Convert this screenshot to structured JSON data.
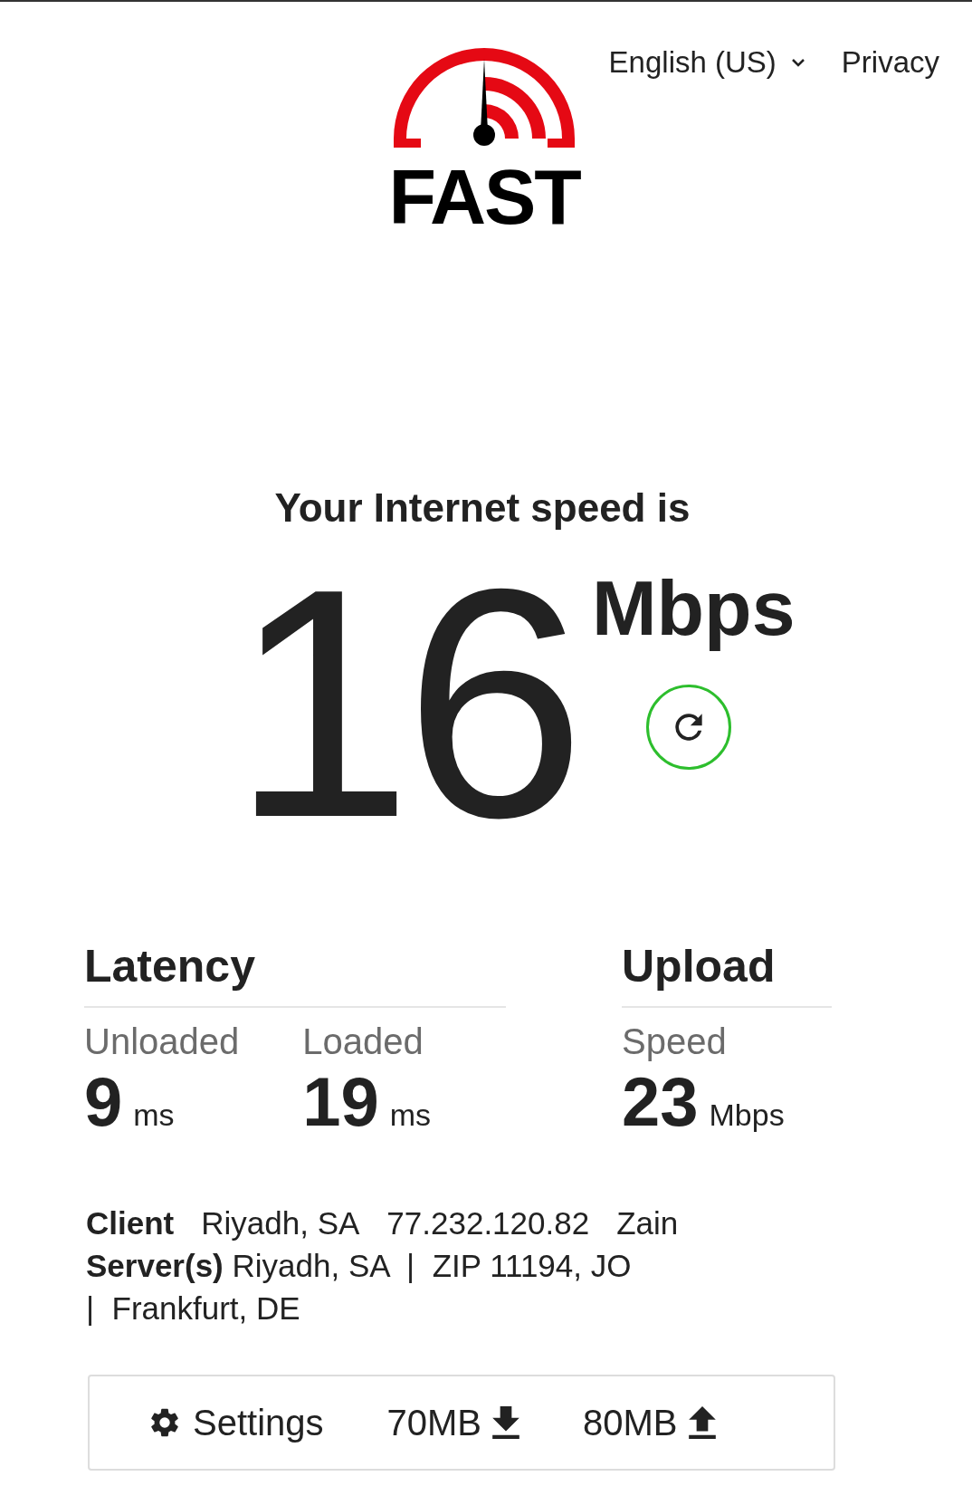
{
  "header": {
    "logo_text": "FAST",
    "language": "English (US)",
    "privacy": "Privacy"
  },
  "result": {
    "headline": "Your Internet speed is",
    "speed": "16",
    "unit": "Mbps"
  },
  "latency": {
    "title": "Latency",
    "metrics": [
      {
        "label": "Unloaded",
        "value": "9",
        "unit": "ms"
      },
      {
        "label": "Loaded",
        "value": "19",
        "unit": "ms"
      }
    ]
  },
  "upload": {
    "title": "Upload",
    "metrics": [
      {
        "label": "Speed",
        "value": "23",
        "unit": "Mbps"
      }
    ]
  },
  "client": {
    "label": "Client",
    "values": [
      "Riyadh, SA",
      "77.232.120.82",
      "Zain"
    ]
  },
  "servers": "**Server(s)** Riyadh, SA  |  ZIP 11194, JO  |  Frankfurt, DE",
  "settings_bar": {
    "settings": "Settings",
    "download": "70MB",
    "upload": "80MB"
  }
}
